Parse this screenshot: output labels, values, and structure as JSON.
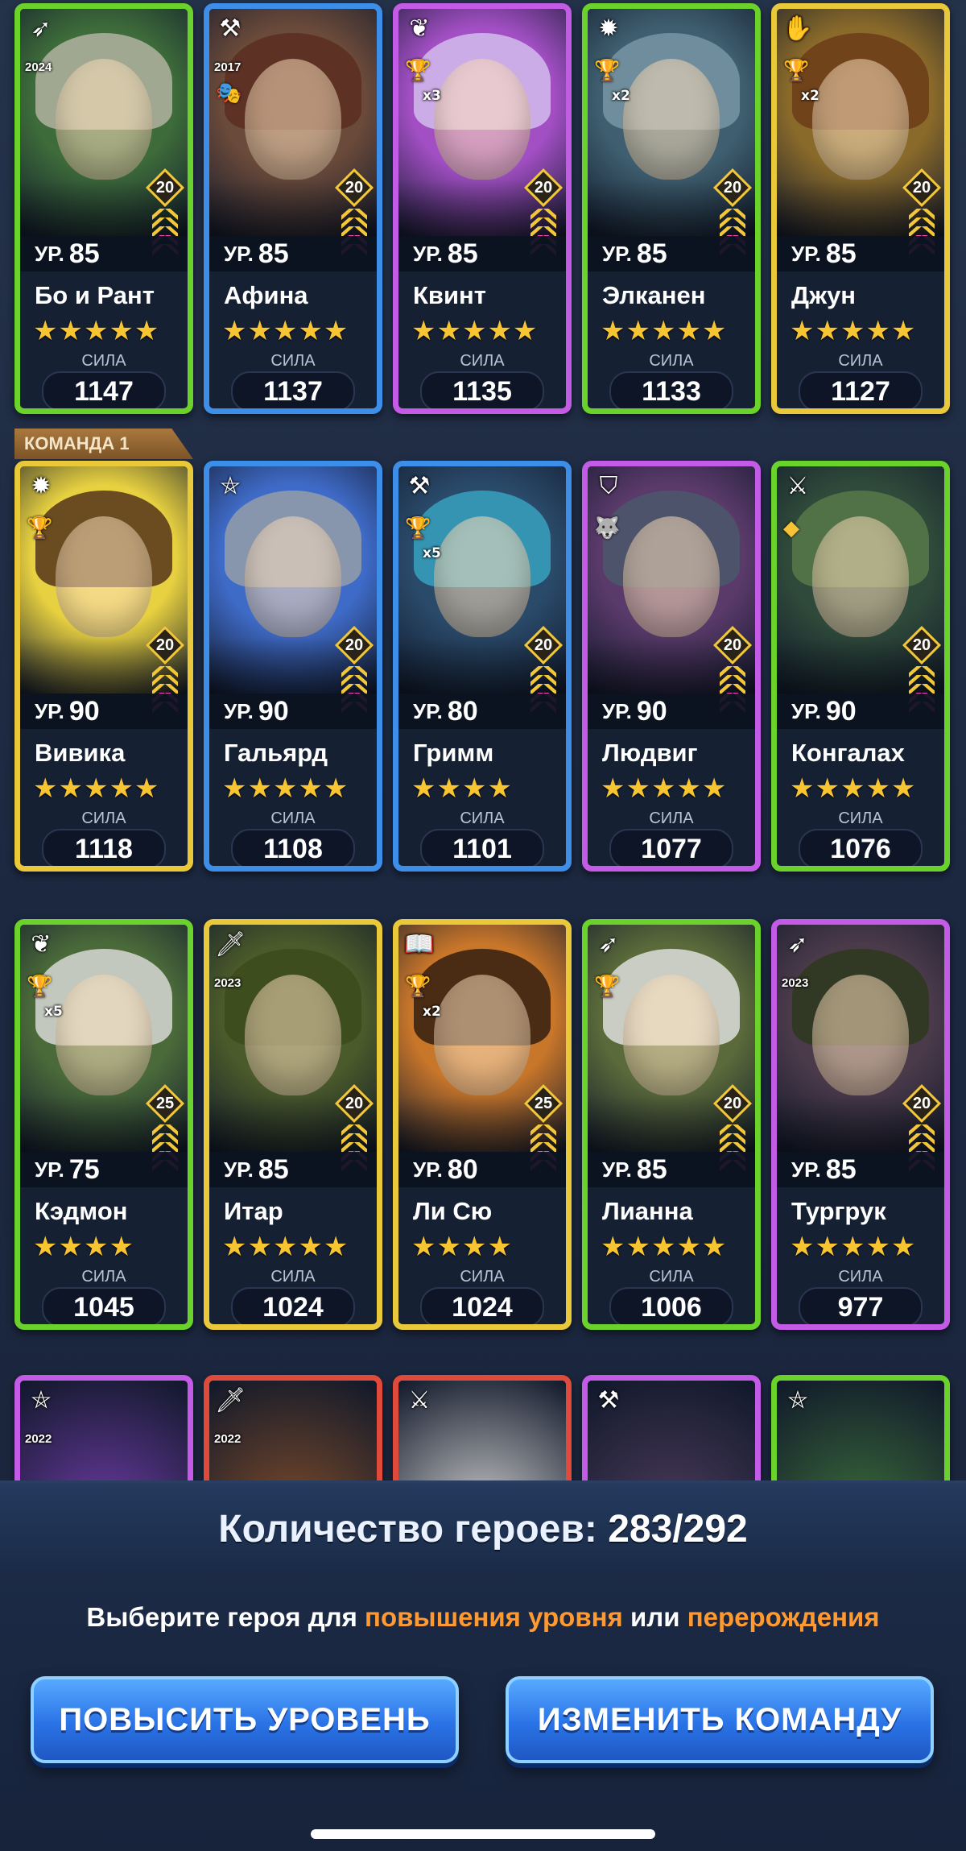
{
  "level_prefix": "УР.",
  "power_label": "СИЛА",
  "team_label": "КОМАНДА 1",
  "rows": [
    [
      {
        "name": "Бо и Рант",
        "level": "85",
        "stars": "★★★★★",
        "power": "1147",
        "rank": "20",
        "frame": "green",
        "class_icon": "bow-icon",
        "badge": "2024",
        "bg": "#3d6b3a",
        "hair": "#b9b8a8",
        "mini": "",
        "mini_mult": ""
      },
      {
        "name": "Афина",
        "level": "85",
        "stars": "★★★★★",
        "power": "1137",
        "rank": "20",
        "frame": "blue",
        "class_icon": "axe-icon",
        "badge": "2017",
        "bg": "#6a4a3a",
        "hair": "#5a2b1f",
        "mini": "mask",
        "mini_mult": ""
      },
      {
        "name": "Квинт",
        "level": "85",
        "stars": "★★★★★",
        "power": "1135",
        "rank": "20",
        "frame": "purple",
        "class_icon": "feather-icon",
        "badge": "",
        "bg": "#a24fc4",
        "hair": "#d7c3ef",
        "mini": "trophy",
        "mini_mult": "x3"
      },
      {
        "name": "Элканен",
        "level": "85",
        "stars": "★★★★★",
        "power": "1133",
        "rank": "20",
        "frame": "green",
        "class_icon": "sun-icon",
        "badge": "",
        "bg": "#3f5f70",
        "hair": "#7c98a8",
        "mini": "trophy",
        "mini_mult": "x2"
      },
      {
        "name": "Джун",
        "level": "85",
        "stars": "★★★★★",
        "power": "1127",
        "rank": "20",
        "frame": "gold",
        "class_icon": "fist-icon",
        "badge": "",
        "bg": "#8a6a2a",
        "hair": "#6a3a18",
        "mini": "trophy",
        "mini_mult": "x2"
      }
    ],
    [
      {
        "name": "Вивика",
        "level": "90",
        "stars": "★★★★★",
        "power": "1118",
        "rank": "20",
        "frame": "gold",
        "class_icon": "sun-icon",
        "badge": "",
        "bg": "#e8d140",
        "hair": "#4a2a18",
        "mini": "trophy",
        "mini_mult": ""
      },
      {
        "name": "Гальярд",
        "level": "90",
        "stars": "★★★★★",
        "power": "1108",
        "rank": "20",
        "frame": "blue",
        "class_icon": "pentagram-icon",
        "badge": "",
        "bg": "#3f6bc8",
        "hair": "#9aa0a6",
        "mini": "",
        "mini_mult": ""
      },
      {
        "name": "Гримм",
        "level": "80",
        "stars": "★★★★",
        "power": "1101",
        "rank": "20",
        "frame": "blue",
        "class_icon": "axe-icon",
        "badge": "",
        "bg": "#2a4a6a",
        "hair": "#3aa6c6",
        "mini": "trophy",
        "mini_mult": "x5"
      },
      {
        "name": "Людвиг",
        "level": "90",
        "stars": "★★★★★",
        "power": "1077",
        "rank": "20",
        "frame": "purple",
        "class_icon": "shield-icon",
        "badge": "",
        "bg": "#5a3a6a",
        "hair": "#4a5a6a",
        "mini": "wolf",
        "mini_mult": ""
      },
      {
        "name": "Конгалах",
        "level": "90",
        "stars": "★★★★★",
        "power": "1076",
        "rank": "20",
        "frame": "green",
        "class_icon": "crossed-swords-icon",
        "badge": "",
        "bg": "#2f4a3a",
        "hair": "#5a7a4a",
        "mini": "gem",
        "mini_mult": ""
      }
    ],
    [
      {
        "name": "Кэдмон",
        "level": "75",
        "stars": "★★★★",
        "power": "1045",
        "rank": "25",
        "frame": "green",
        "class_icon": "feather-icon",
        "badge": "",
        "bg": "#4a6a3a",
        "hair": "#e0e0e0",
        "mini": "trophy",
        "mini_mult": "x5"
      },
      {
        "name": "Итар",
        "level": "85",
        "stars": "★★★★★",
        "power": "1024",
        "rank": "20",
        "frame": "gold",
        "class_icon": "dagger-icon",
        "badge": "2023",
        "bg": "#4a5a2a",
        "hair": "#3a4a1a",
        "mini": "",
        "mini_mult": ""
      },
      {
        "name": "Ли Сю",
        "level": "80",
        "stars": "★★★★",
        "power": "1024",
        "rank": "25",
        "frame": "gold",
        "class_icon": "book-icon",
        "badge": "",
        "bg": "#c8762a",
        "hair": "#2a1a10",
        "mini": "trophy",
        "mini_mult": "x2"
      },
      {
        "name": "Лианна",
        "level": "85",
        "stars": "★★★★★",
        "power": "1006",
        "rank": "20",
        "frame": "green",
        "class_icon": "bow-icon",
        "badge": "",
        "bg": "#5a6a3a",
        "hair": "#e6e6e6",
        "mini": "trophy",
        "mini_mult": ""
      },
      {
        "name": "Тургрук",
        "level": "85",
        "stars": "★★★★★",
        "power": "977",
        "rank": "20",
        "frame": "purple",
        "class_icon": "bow-icon",
        "badge": "2023",
        "bg": "#4a3a4a",
        "hair": "#2a3a1a",
        "mini": "",
        "mini_mult": ""
      }
    ]
  ],
  "partial_row": [
    {
      "frame": "purple",
      "class_icon": "pentagram-icon",
      "badge": "2022",
      "bg": "#6a3aa0"
    },
    {
      "frame": "red",
      "class_icon": "dagger-icon",
      "badge": "2022",
      "bg": "#7a4a2a"
    },
    {
      "frame": "red",
      "class_icon": "crossed-swords-icon",
      "badge": "",
      "bg": "#c8c8c8"
    },
    {
      "frame": "purple",
      "class_icon": "axe-icon",
      "badge": "",
      "bg": "#4a3a5a"
    },
    {
      "frame": "green",
      "class_icon": "pentagram-icon",
      "badge": "",
      "bg": "#3a6a3a"
    }
  ],
  "footer": {
    "count_label": "Количество героев:",
    "count_value": "283/292",
    "hint_pre": "Выберите героя для ",
    "hint_accent1": "повышения уровня",
    "hint_mid": " или ",
    "hint_accent2": "перерождения",
    "btn_level_up": "ПОВЫСИТЬ УРОВЕНЬ",
    "btn_change_team": "ИЗМЕНИТЬ КОМАНДУ"
  },
  "colors": {
    "frame_green": "#6bd22b",
    "frame_blue": "#3d8ee8",
    "frame_purple": "#c45be6",
    "frame_gold": "#e9c83a",
    "frame_red": "#e04a3a",
    "accent_orange": "#ff9a33",
    "button_blue": "#2a73e6"
  }
}
